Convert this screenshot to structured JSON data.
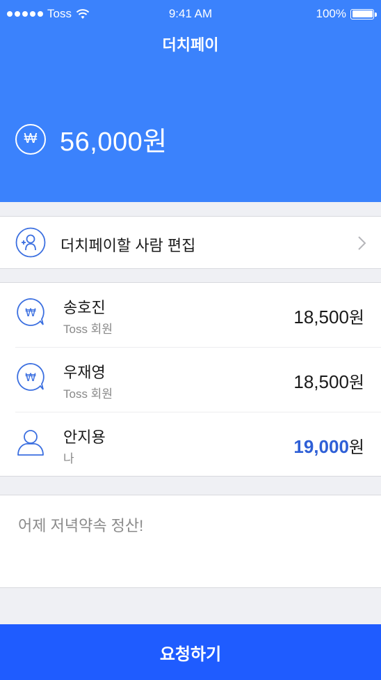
{
  "status_bar": {
    "carrier": "Toss",
    "time": "9:41 AM",
    "battery": "100%"
  },
  "header": {
    "title": "더치페이",
    "total_amount": "56,000원",
    "currency_symbol": "₩"
  },
  "edit": {
    "label": "더치페이할 사람 편집"
  },
  "members": [
    {
      "name": "송호진",
      "subtitle": "Toss 회원",
      "amount": "18,500",
      "unit": "원",
      "icon": "won-bubble-icon"
    },
    {
      "name": "우재영",
      "subtitle": "Toss 회원",
      "amount": "18,500",
      "unit": "원",
      "icon": "won-bubble-icon"
    },
    {
      "name": "안지용",
      "subtitle": "나",
      "amount": "19,000",
      "unit": "원",
      "icon": "person-icon"
    }
  ],
  "memo": {
    "text": "어제 저녁약속 정산!"
  },
  "action": {
    "request_label": "요청하기"
  },
  "colors": {
    "header_bg": "#3b82fc",
    "button_bg": "#1f5cff",
    "accent_blue": "#2e5fd6"
  }
}
